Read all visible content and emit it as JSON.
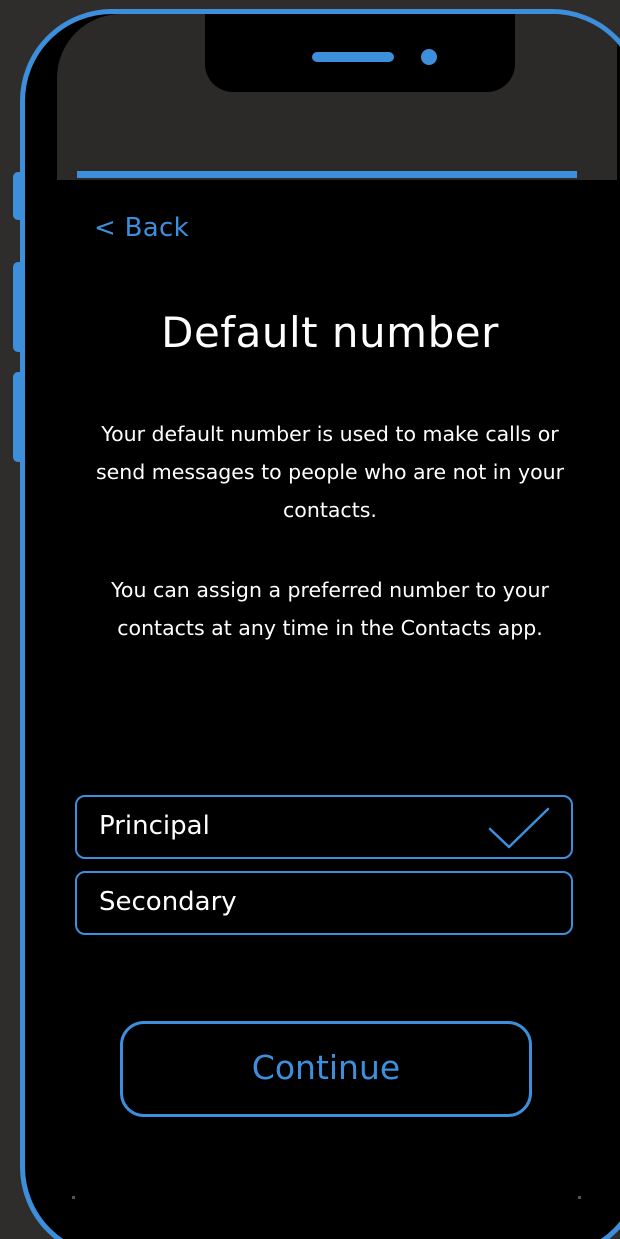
{
  "nav": {
    "back_label": "< Back"
  },
  "header": {
    "title": "Default number"
  },
  "description": {
    "paragraph1": "Your default number is used to make calls or send messages to people who are not in your contacts.",
    "paragraph2": "You can assign a preferred number to your contacts at any time in the Contacts app."
  },
  "options": [
    {
      "label": "Principal",
      "selected": true
    },
    {
      "label": "Secondary",
      "selected": false
    }
  ],
  "actions": {
    "continue_label": "Continue"
  },
  "theme": {
    "accent": "#3d8fdc",
    "screen_background": "#000000",
    "page_background": "#2f2d2b",
    "text": "#ffffff"
  },
  "icons": {
    "selected_indicator": "checkmark-icon"
  }
}
